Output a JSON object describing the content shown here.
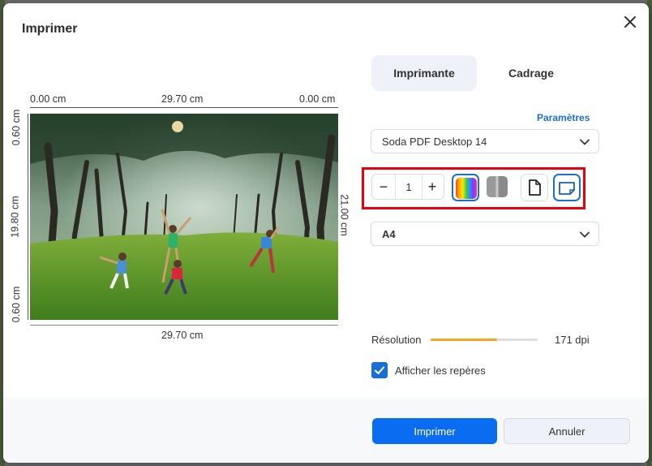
{
  "dialog": {
    "title": "Imprimer",
    "close_icon": "close-icon"
  },
  "preview": {
    "top_left": "0.00 cm",
    "top_center": "29.70 cm",
    "top_right": "0.00 cm",
    "bottom_center": "29.70 cm",
    "left_top": "0.60 cm",
    "left_middle": "19.80 cm",
    "left_bottom": "0.60 cm",
    "right_middle": "21.00 cm"
  },
  "tabs": [
    {
      "label": "Imprimante",
      "active": true
    },
    {
      "label": "Cadrage",
      "active": false
    }
  ],
  "settings": {
    "params_link": "Paramètres",
    "printer": "Soda PDF Desktop 14",
    "paper": "A4",
    "copies": "1",
    "minus": "−",
    "plus": "+"
  },
  "resolution": {
    "label": "Résolution",
    "value": "171 dpi",
    "level": 0.62
  },
  "show_marks": {
    "label": "Afficher les repères",
    "checked": true
  },
  "buttons": {
    "print": "Imprimer",
    "cancel": "Annuler"
  },
  "colors": {
    "accent": "#0a6cf0",
    "highlight": "#e8000a",
    "slider": "#f5a623"
  }
}
